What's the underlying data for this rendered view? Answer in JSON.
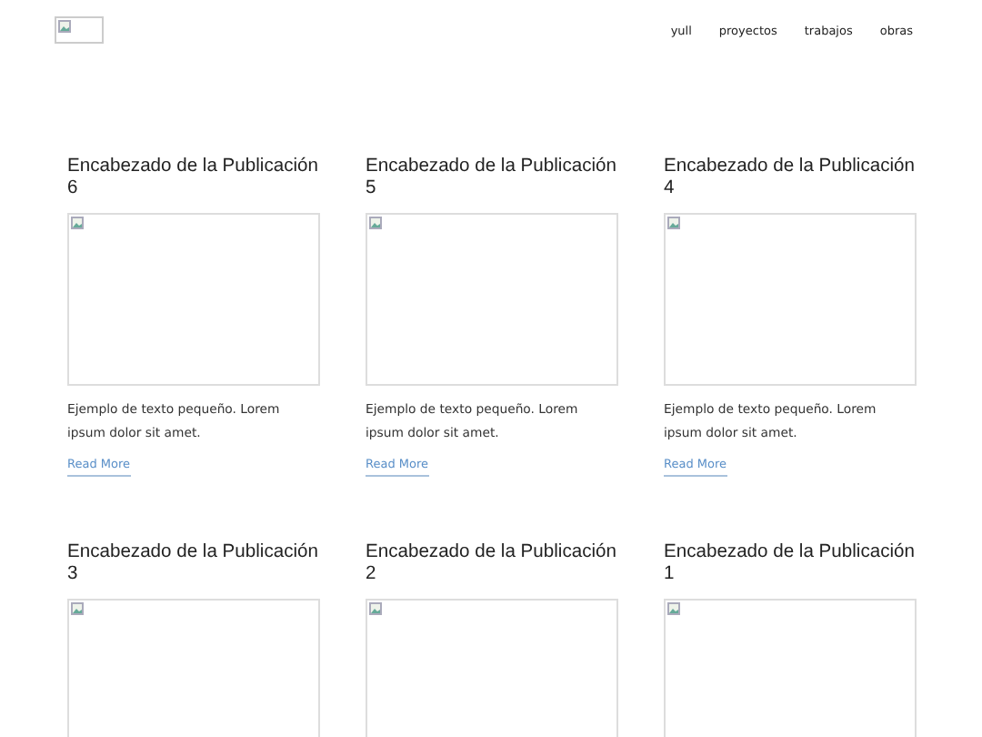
{
  "nav": {
    "items": [
      "yull",
      "proyectos",
      "trabajos",
      "obras"
    ]
  },
  "posts": [
    {
      "title": "Encabezado de la Publicación 6",
      "excerpt": "Ejemplo de texto pequeño. Lorem ipsum dolor sit amet.",
      "link": "Read More"
    },
    {
      "title": "Encabezado de la Publicación 5",
      "excerpt": "Ejemplo de texto pequeño. Lorem ipsum dolor sit amet.",
      "link": "Read More"
    },
    {
      "title": "Encabezado de la Publicación 4",
      "excerpt": "Ejemplo de texto pequeño. Lorem ipsum dolor sit amet.",
      "link": "Read More"
    },
    {
      "title": "Encabezado de la Publicación 3"
    },
    {
      "title": "Encabezado de la Publicación 2"
    },
    {
      "title": "Encabezado de la Publicación 1"
    }
  ]
}
